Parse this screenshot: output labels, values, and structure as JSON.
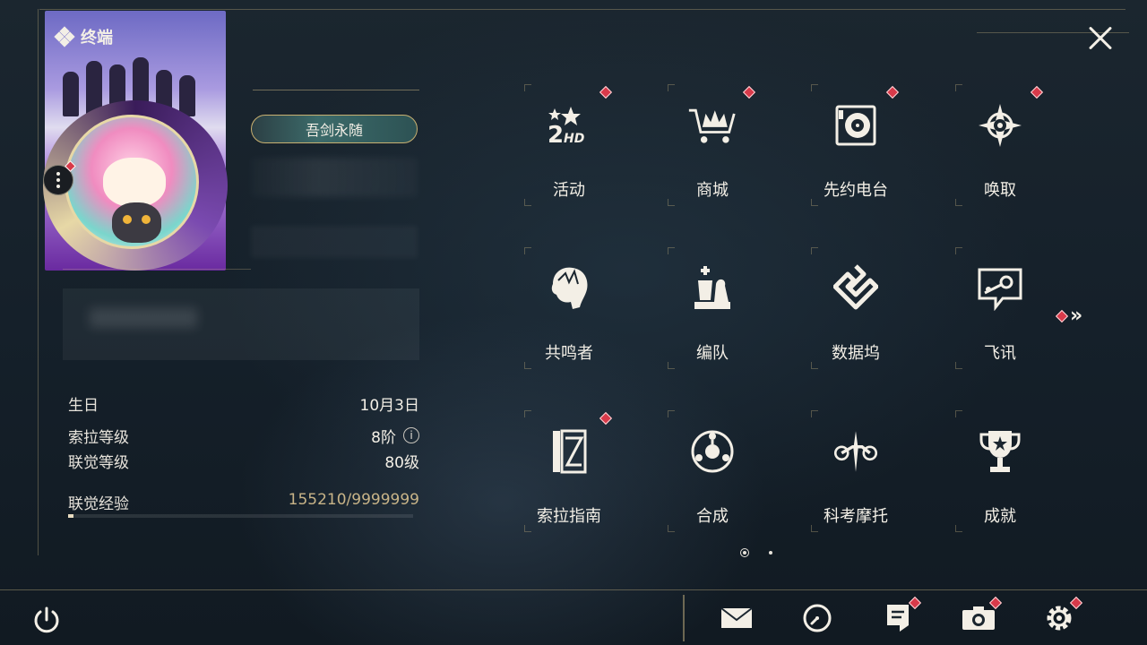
{
  "header": {
    "title": "终端"
  },
  "profile": {
    "title_badge": "吾剑永随",
    "stats": [
      {
        "label": "生日",
        "value": "10月3日"
      },
      {
        "label": "索拉等级",
        "value": "8阶"
      },
      {
        "label": "联觉等级",
        "value": "80级"
      }
    ],
    "exp_label": "联觉经验",
    "exp_value": "155210/9999999",
    "exp_fraction": 0.0155
  },
  "menu": [
    {
      "label": "活动",
      "icon": "event-2hd-icon",
      "badge": true
    },
    {
      "label": "商城",
      "icon": "crown-cart-icon",
      "badge": true
    },
    {
      "label": "先约电台",
      "icon": "radio-disc-icon",
      "badge": true
    },
    {
      "label": "唤取",
      "icon": "compass-star-icon",
      "badge": true
    },
    {
      "label": "共鸣者",
      "icon": "resonator-head-icon",
      "badge": false
    },
    {
      "label": "编队",
      "icon": "chess-pieces-icon",
      "badge": false
    },
    {
      "label": "数据坞",
      "icon": "data-dock-icon",
      "badge": false
    },
    {
      "label": "飞讯",
      "icon": "chat-bubble-icon",
      "badge": false
    },
    {
      "label": "索拉指南",
      "icon": "guide-book-icon",
      "badge": true
    },
    {
      "label": "合成",
      "icon": "synthesis-icon",
      "badge": false
    },
    {
      "label": "科考摩托",
      "icon": "motorbike-icon",
      "badge": false
    },
    {
      "label": "成就",
      "icon": "trophy-icon",
      "badge": false
    }
  ],
  "colors": {
    "accent_gold": "#c8b070",
    "badge_red": "#d83a4a"
  }
}
